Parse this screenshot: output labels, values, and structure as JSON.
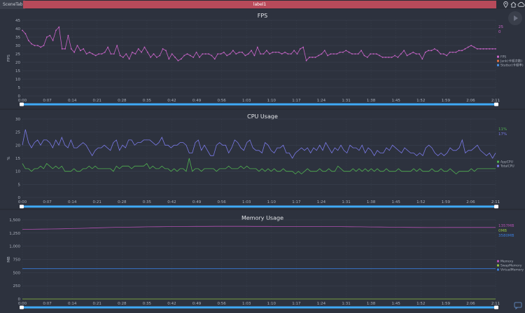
{
  "tabs": {
    "scene_tab": "SceneTab",
    "active_tab": "label1"
  },
  "colors": {
    "bg": "#2d323e",
    "grid": "#3e4452",
    "axis_text": "#aab0bc",
    "title": "#e6e8ec",
    "scroll_bar": "#3fa9f5",
    "fps": "#c864c8",
    "jank": "#e07040",
    "stutter": "#4a90e2",
    "appcpu": "#50b050",
    "totalcpu": "#7a7ae8",
    "memory": "#b050b0",
    "swap": "#90c040",
    "virtual": "#3a7cd8"
  },
  "x_ticks": [
    "0:00",
    "0:07",
    "0:14",
    "0:21",
    "0:28",
    "0:35",
    "0:42",
    "0:49",
    "0:56",
    "1:03",
    "1:10",
    "1:17",
    "1:24",
    "1:31",
    "1:38",
    "1:45",
    "1:52",
    "1:59",
    "2:06",
    "2:11"
  ],
  "chart_data": [
    {
      "type": "line",
      "title": "FPS",
      "ylabel": "FPS",
      "ylim": [
        0,
        45
      ],
      "yticks": [
        0,
        5,
        10,
        15,
        20,
        25,
        30,
        35,
        40,
        45
      ],
      "legend": [
        "FPS",
        "Jank(卡顿次数)",
        "Stutter(卡顿率)"
      ],
      "current_values": [
        "25",
        "0"
      ],
      "series": [
        {
          "name": "FPS",
          "values": [
            39,
            37,
            33,
            31,
            30,
            30,
            29,
            30,
            35,
            36,
            33,
            39,
            41,
            28,
            28,
            36,
            28,
            26,
            30,
            27,
            28,
            25,
            26,
            25,
            24,
            25,
            25,
            26,
            29,
            25,
            25,
            30,
            24,
            23,
            25,
            22,
            26,
            25,
            28,
            26,
            29,
            26,
            23,
            25,
            23,
            24,
            28,
            27,
            22,
            25,
            23,
            21,
            22,
            24,
            25,
            24,
            23,
            26,
            23,
            25,
            25,
            25,
            24,
            22,
            25,
            25,
            26,
            24,
            25,
            27,
            25,
            26,
            26,
            24,
            25,
            27,
            24,
            29,
            25,
            25,
            27,
            25,
            26,
            26,
            26,
            25,
            26,
            25,
            25,
            27,
            25,
            28,
            29,
            21,
            23,
            23,
            23,
            24,
            25,
            27,
            24,
            25,
            25,
            25,
            26,
            26,
            27,
            26,
            25,
            25,
            25,
            27,
            24,
            23,
            25,
            25,
            25,
            24,
            23,
            23,
            23,
            23,
            24,
            23,
            25,
            27,
            24,
            25,
            26,
            25,
            25,
            22,
            26,
            27,
            27,
            28,
            27,
            25,
            25,
            24,
            26,
            26,
            26,
            27,
            27,
            28,
            29,
            30,
            29,
            28,
            28,
            28,
            28,
            28,
            28,
            28
          ]
        }
      ]
    },
    {
      "type": "line",
      "title": "CPU Usage",
      "ylabel": "%",
      "ylim": [
        0,
        30
      ],
      "yticks": [
        0,
        5,
        10,
        15,
        20,
        25,
        30
      ],
      "legend": [
        "AppCPU",
        "TotalCPU"
      ],
      "current_values": [
        "11%",
        "17%"
      ],
      "series": [
        {
          "name": "AppCPU",
          "values": [
            13,
            11,
            11,
            10,
            11,
            11,
            12,
            11,
            13,
            12,
            11,
            12,
            11,
            12,
            10,
            10,
            10,
            11,
            10,
            10,
            11,
            11,
            12,
            11,
            12,
            11,
            11,
            11,
            11,
            11,
            10,
            12,
            11,
            12,
            12,
            12,
            11,
            12,
            12,
            12,
            12,
            13,
            11,
            12,
            11,
            11,
            12,
            11,
            11,
            10,
            11,
            10,
            11,
            11,
            10,
            15,
            10,
            11,
            11,
            10,
            11,
            11,
            11,
            11,
            10,
            11,
            11,
            11,
            12,
            11,
            11,
            11,
            12,
            11,
            12,
            11,
            11,
            11,
            10,
            11,
            10,
            11,
            10,
            11,
            10,
            10,
            11,
            10,
            10,
            10,
            9,
            10,
            9,
            10,
            11,
            10,
            10,
            10,
            11,
            10,
            10,
            11,
            10,
            10,
            12,
            11,
            10,
            10,
            10,
            11,
            10,
            11,
            10,
            11,
            10,
            11,
            10,
            11,
            10,
            10,
            11,
            10,
            10,
            10,
            11,
            10,
            10,
            10,
            10,
            11,
            10,
            11,
            10,
            10,
            10,
            11,
            10,
            10,
            11,
            10,
            10,
            11,
            10,
            9,
            10,
            10,
            10,
            10,
            11,
            10,
            11,
            11,
            11,
            11,
            11,
            11,
            11
          ]
        },
        {
          "name": "TotalCPU",
          "values": [
            20,
            26,
            21,
            19,
            21,
            22,
            20,
            22,
            22,
            21,
            19,
            22,
            20,
            23,
            20,
            19,
            22,
            19,
            19,
            20,
            21,
            20,
            18,
            16,
            18,
            19,
            19,
            20,
            19,
            18,
            21,
            22,
            18,
            20,
            19,
            22,
            22,
            20,
            21,
            21,
            22,
            22,
            22,
            21,
            20,
            21,
            23,
            20,
            20,
            19,
            20,
            20,
            21,
            21,
            20,
            17,
            17,
            21,
            22,
            18,
            20,
            18,
            16,
            16,
            20,
            21,
            20,
            20,
            17,
            19,
            22,
            21,
            19,
            18,
            21,
            22,
            19,
            18,
            18,
            17,
            21,
            20,
            18,
            17,
            19,
            19,
            20,
            17,
            17,
            15,
            17,
            18,
            19,
            18,
            19,
            17,
            19,
            18,
            20,
            18,
            21,
            19,
            17,
            19,
            18,
            20,
            18,
            17,
            20,
            19,
            19,
            18,
            20,
            17,
            19,
            18,
            16,
            18,
            17,
            17,
            19,
            18,
            20,
            19,
            18,
            17,
            19,
            18,
            17,
            17,
            16,
            17,
            16,
            19,
            20,
            19,
            17,
            16,
            17,
            16,
            17,
            19,
            18,
            18,
            19,
            22,
            17,
            18,
            18,
            19,
            20,
            18,
            17,
            16,
            17,
            15,
            17
          ]
        }
      ]
    },
    {
      "type": "line",
      "title": "Memory Usage",
      "ylabel": "MB",
      "ylim": [
        0,
        1500
      ],
      "yticks": [
        "0",
        "250",
        "500",
        "750",
        "1,000",
        "1,250",
        "1,500"
      ],
      "legend": [
        "Memory",
        "SwapMemory",
        "VirtualMemory"
      ],
      "current_values": [
        "1357MB",
        "0MB",
        "3580MB"
      ],
      "series": [
        {
          "name": "Memory",
          "values": [
            1320,
            1322,
            1325,
            1328,
            1330,
            1335,
            1340,
            1345,
            1350,
            1355,
            1360,
            1362,
            1365,
            1368,
            1370,
            1372,
            1374,
            1375,
            1376,
            1377,
            1378,
            1378,
            1378,
            1378,
            1377,
            1376,
            1375,
            1375,
            1374,
            1374,
            1373,
            1373,
            1372,
            1372,
            1370,
            1368,
            1366,
            1364,
            1362,
            1360,
            1358,
            1356,
            1355,
            1355,
            1356,
            1357,
            1357,
            1357,
            1357,
            1357
          ]
        },
        {
          "name": "SwapMemory",
          "values": [
            0,
            0,
            0,
            0,
            0,
            0,
            0,
            0,
            0,
            0,
            0,
            0,
            0,
            0,
            0,
            0,
            0,
            0,
            0,
            0,
            0,
            0,
            0,
            0,
            0,
            0,
            0,
            0,
            0,
            0,
            0,
            0,
            0,
            0,
            0,
            0,
            0,
            0,
            0,
            0,
            0,
            0,
            0,
            0,
            0,
            0,
            0,
            0,
            0,
            0
          ]
        },
        {
          "name": "VirtualMemory",
          "values": [
            575,
            575,
            575,
            575,
            575,
            575,
            575,
            575,
            575,
            575,
            575,
            575,
            575,
            575,
            575,
            575,
            575,
            575,
            575,
            575,
            575,
            575,
            575,
            575,
            575,
            575,
            575,
            575,
            575,
            575,
            575,
            575,
            575,
            575,
            575,
            575,
            575,
            575,
            575,
            575,
            575,
            575,
            575,
            575,
            575,
            575,
            575,
            575,
            575,
            575
          ]
        }
      ]
    }
  ]
}
